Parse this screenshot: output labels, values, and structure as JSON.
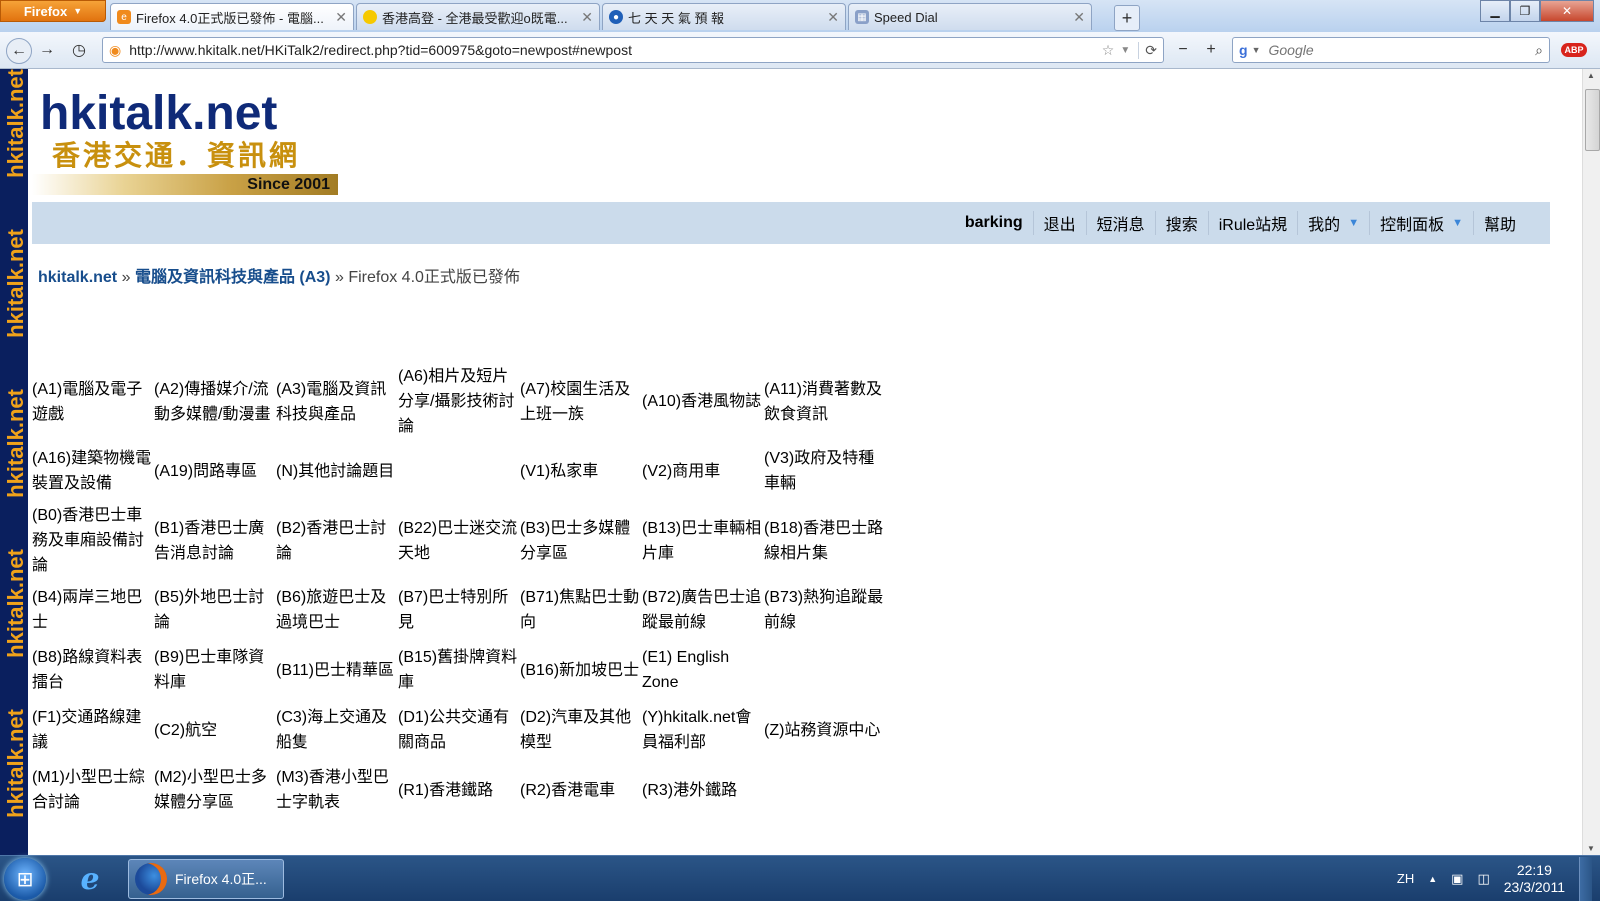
{
  "browser": {
    "menu_label": "Firefox",
    "tabs": [
      {
        "label": "Firefox 4.0正式版已發佈 - 電腦...",
        "active": true,
        "icon": "hkitalk-favicon",
        "color": "#f08a1c"
      },
      {
        "label": "香港高登 - 全港最受歡迎o既電...",
        "active": false,
        "icon": "golden-favicon",
        "color": "#f6c900"
      },
      {
        "label": "七 天 天 氣 預 報",
        "active": false,
        "icon": "hko-favicon",
        "color": "#1f5fb8"
      },
      {
        "label": "Speed Dial",
        "active": false,
        "icon": "speed-dial-icon",
        "color": "#8aa0c8"
      }
    ],
    "url": "http://www.hkitalk.net/HKiTalk2/redirect.php?tid=600975&goto=newpost#newpost",
    "search_placeholder": "Google"
  },
  "site": {
    "logo_main": "hkitalk.net",
    "logo_sub": "香港交通．資訊網",
    "logo_since": "Since 2001",
    "side_watermark": "hkitalk.net",
    "userbar": {
      "username": "barking",
      "items": [
        "退出",
        "短消息",
        "搜索",
        "iRule站規",
        "我的",
        "控制面板",
        "幫助"
      ]
    },
    "breadcrumb": {
      "home": "hkitalk.net",
      "section": "電腦及資訊科技與產品 (A3)",
      "current": "Firefox 4.0正式版已發佈",
      "sep": "»"
    },
    "forums": [
      "(A1)電腦及電子遊戲",
      "(A2)傳播媒介/流動多媒體/動漫畫",
      "(A3)電腦及資訊科技與產品",
      "(A6)相片及短片分享/攝影技術討論",
      "(A7)校園生活及上班一族",
      "(A10)香港風物誌",
      "(A11)消費著數及飲食資訊",
      "(A16)建築物機電裝置及設備",
      "(A19)問路專區",
      "(N)其他討論題目",
      "",
      "(V1)私家車",
      "(V2)商用車",
      "(V3)政府及特種車輛",
      "(B0)香港巴士車務及車廂設備討論",
      "(B1)香港巴士廣告消息討論",
      "(B2)香港巴士討論",
      "(B22)巴士迷交流天地",
      "(B3)巴士多媒體分享區",
      "(B13)巴士車輛相片庫",
      "(B18)香港巴士路線相片集",
      "(B4)兩岸三地巴士",
      "(B5)外地巴士討論",
      "(B6)旅遊巴士及過境巴士",
      "(B7)巴士特別所見",
      "(B71)焦點巴士動向",
      "(B72)廣告巴士追蹤最前線",
      "(B73)熱狗追蹤最前線",
      "(B8)路線資料表擂台",
      "(B9)巴士車隊資料庫",
      "(B11)巴士精華區",
      "(B15)舊掛牌資料庫",
      "(B16)新加坡巴士",
      "(E1) English Zone",
      "",
      "(F1)交通路線建議",
      "(C2)航空",
      "(C3)海上交通及船隻",
      "(D1)公共交通有關商品",
      "(D2)汽車及其他模型",
      "(Y)hkitalk.net會員福利部",
      "(Z)站務資源中心",
      "(M1)小型巴士綜合討論",
      "(M2)小型巴士多媒體分享區",
      "(M3)香港小型巴士字軌表",
      "(R1)香港鐵路",
      "(R2)香港電車",
      "(R3)港外鐵路",
      ""
    ]
  },
  "taskbar": {
    "task_label": "Firefox 4.0正...",
    "lang": "ZH",
    "time": "22:19",
    "date": "23/3/2011"
  },
  "colors": {
    "brand_navy": "#0f2a78",
    "brand_gold": "#c8900e",
    "userbar_bg": "#cbdbeb",
    "link": "#174d8c"
  }
}
